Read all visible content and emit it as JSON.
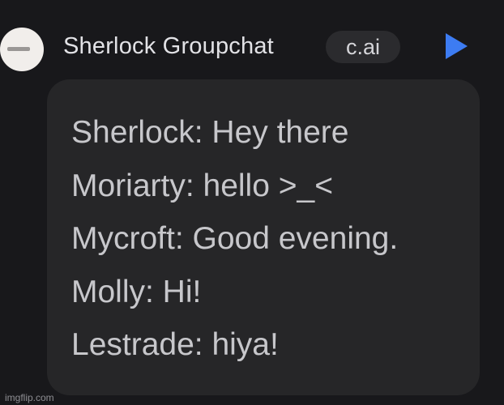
{
  "header": {
    "chat_name": "Sherlock Groupchat",
    "tag": "c.ai",
    "play_icon": "play-icon"
  },
  "messages": [
    "Sherlock: Hey there",
    "Moriarty: hello >_<",
    "Mycroft: Good evening.",
    "Molly: Hi!",
    "Lestrade: hiya!"
  ],
  "watermark": "imgflip.com",
  "colors": {
    "background": "#18181b",
    "bubble": "#262628",
    "tag": "#2b2b2e",
    "accent": "#3d7cf2"
  }
}
